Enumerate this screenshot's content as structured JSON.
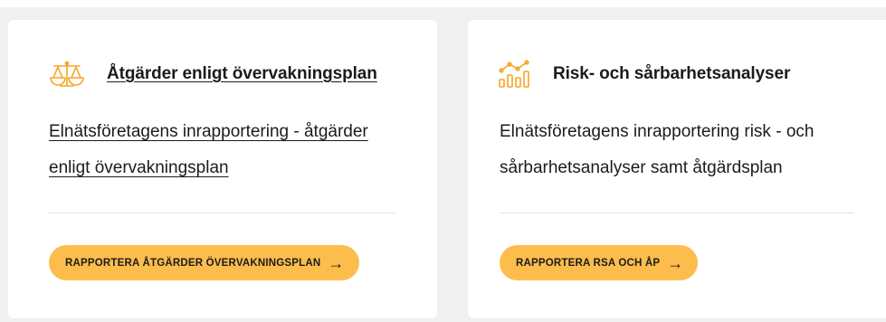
{
  "cards": [
    {
      "icon": "scales-icon",
      "title": "Åtgärder enligt övervakningsplan",
      "description": "Elnätsföretagens inrapportering - åtgärder enligt övervakningsplan",
      "button": "RAPPORTERA ÅTGÄRDER ÖVERVAKNINGSPLAN"
    },
    {
      "icon": "analytics-chart-icon",
      "title": "Risk- och sårbarhetsanalyser",
      "description": "Elnätsföretagens inrapportering risk - och sårbarhetsanalyser samt åtgärdsplan",
      "button": "RAPPORTERA RSA OCH ÅP"
    }
  ],
  "colors": {
    "accent": "#fdbd4d",
    "icon": "#f5a623",
    "background": "#f0f0f0",
    "card": "#ffffff"
  },
  "arrow_glyph": "→"
}
